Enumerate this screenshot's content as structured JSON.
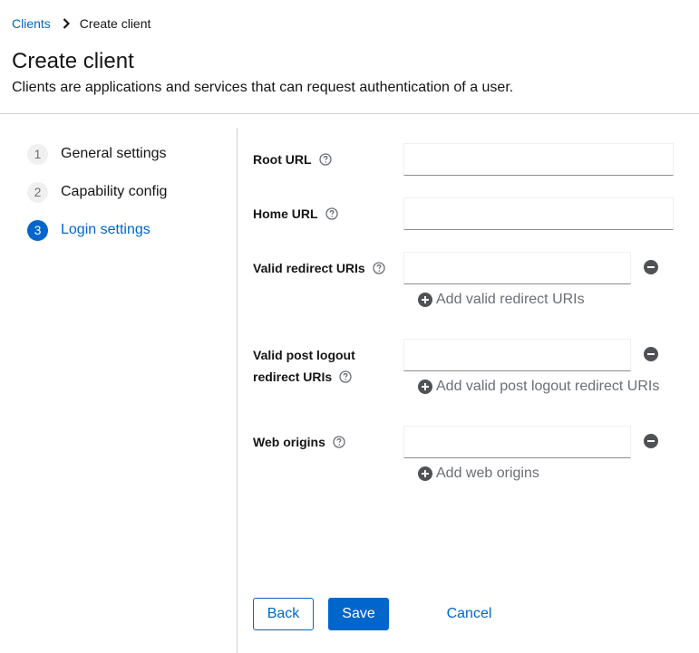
{
  "breadcrumb": {
    "parent": "Clients",
    "current": "Create client"
  },
  "header": {
    "title": "Create client",
    "description": "Clients are applications and services that can request authentication of a user."
  },
  "wizard": {
    "steps": [
      {
        "number": "1",
        "label": "General settings"
      },
      {
        "number": "2",
        "label": "Capability config"
      },
      {
        "number": "3",
        "label": "Login settings"
      }
    ],
    "current_step": "3"
  },
  "form": {
    "root_url": {
      "label": "Root URL",
      "value": ""
    },
    "home_url": {
      "label": "Home URL",
      "value": ""
    },
    "valid_redirect_uris": {
      "label": "Valid redirect URIs",
      "value": "",
      "add_label": "Add valid redirect URIs"
    },
    "valid_post_logout": {
      "label_line1": "Valid post logout",
      "label_line2": "redirect URIs",
      "value": "",
      "add_label": "Add valid post logout redirect URIs"
    },
    "web_origins": {
      "label": "Web origins",
      "value": "",
      "add_label": "Add web origins"
    }
  },
  "actions": {
    "back": "Back",
    "save": "Save",
    "cancel": "Cancel"
  },
  "colors": {
    "primary": "#0066cc",
    "text": "#151515",
    "muted": "#6a6e73",
    "border": "#d2d2d2"
  },
  "icons": {
    "separator": "chevron-right-icon",
    "help": "question-circle-icon",
    "remove": "minus-circle-icon",
    "add": "plus-circle-icon"
  }
}
